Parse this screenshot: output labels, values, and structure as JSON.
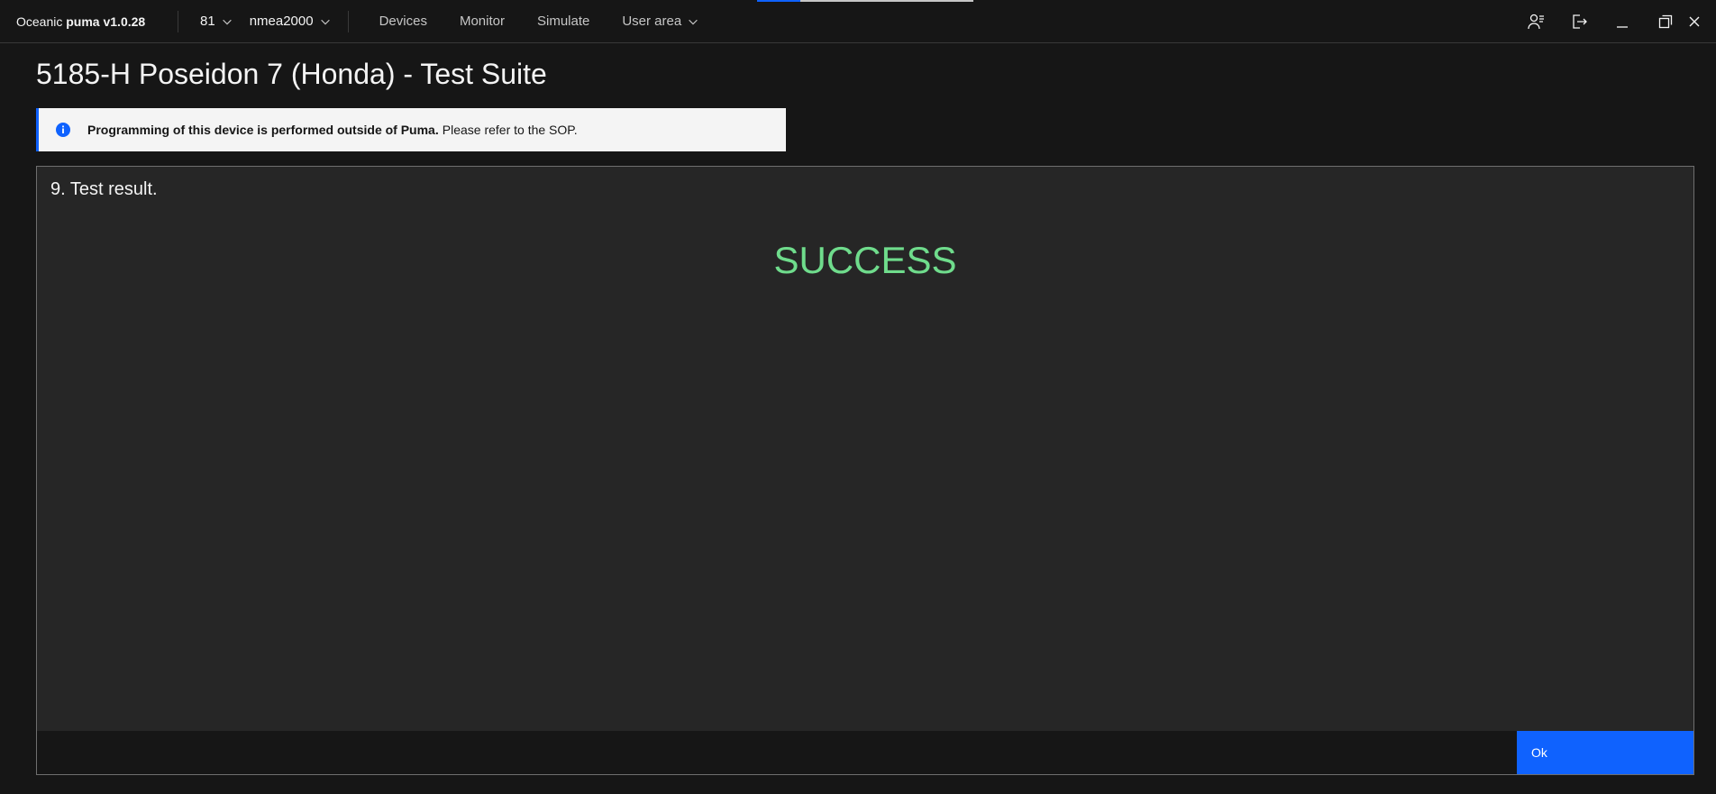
{
  "app": {
    "title_prefix": "Oceanic ",
    "title_bold": "puma v1.0.28"
  },
  "header": {
    "device_select": "81",
    "protocol_select": "nmea2000",
    "nav": [
      "Devices",
      "Monitor",
      "Simulate"
    ],
    "user_area": "User area",
    "icons": [
      "user-list-icon",
      "logout-icon",
      "minimize-icon",
      "restore-icon",
      "close-icon"
    ]
  },
  "page": {
    "title": "5185-H Poseidon 7 (Honda) - Test Suite"
  },
  "notification": {
    "icon": "info-icon",
    "bold_text": "Programming of this device is performed outside of Puma.",
    "text": "Please refer to the SOP."
  },
  "panel": {
    "step": "9. Test result.",
    "result": "SUCCESS",
    "ok_label": "Ok"
  },
  "colors": {
    "accent": "#0f62fe",
    "success": "#6fdc8c",
    "background": "#161616",
    "panel": "#262626"
  }
}
